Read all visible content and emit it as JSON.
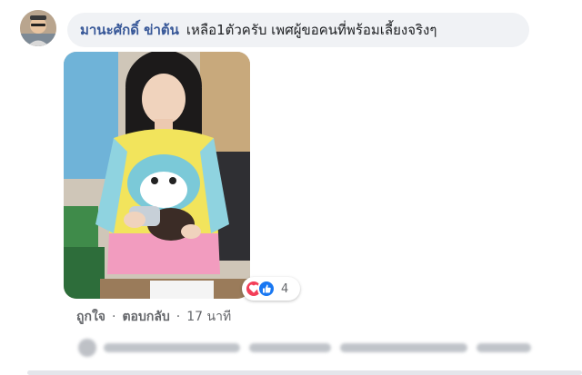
{
  "comment": {
    "author": "มานะศักดิ์ ข่าต้น",
    "text": "เหลือ1ตัวครับ เพศผู้ขอคนที่พร้อมเลี้ยงจริงๆ"
  },
  "reactions": {
    "count": "4",
    "icons": [
      "heart-icon",
      "like-icon"
    ],
    "colors": {
      "love": "#f33e58",
      "like": "#1877f2"
    }
  },
  "actions": {
    "like_label": "ถูกใจ",
    "reply_label": "ตอบกลับ",
    "separator": "·",
    "time": "17 นาที"
  }
}
